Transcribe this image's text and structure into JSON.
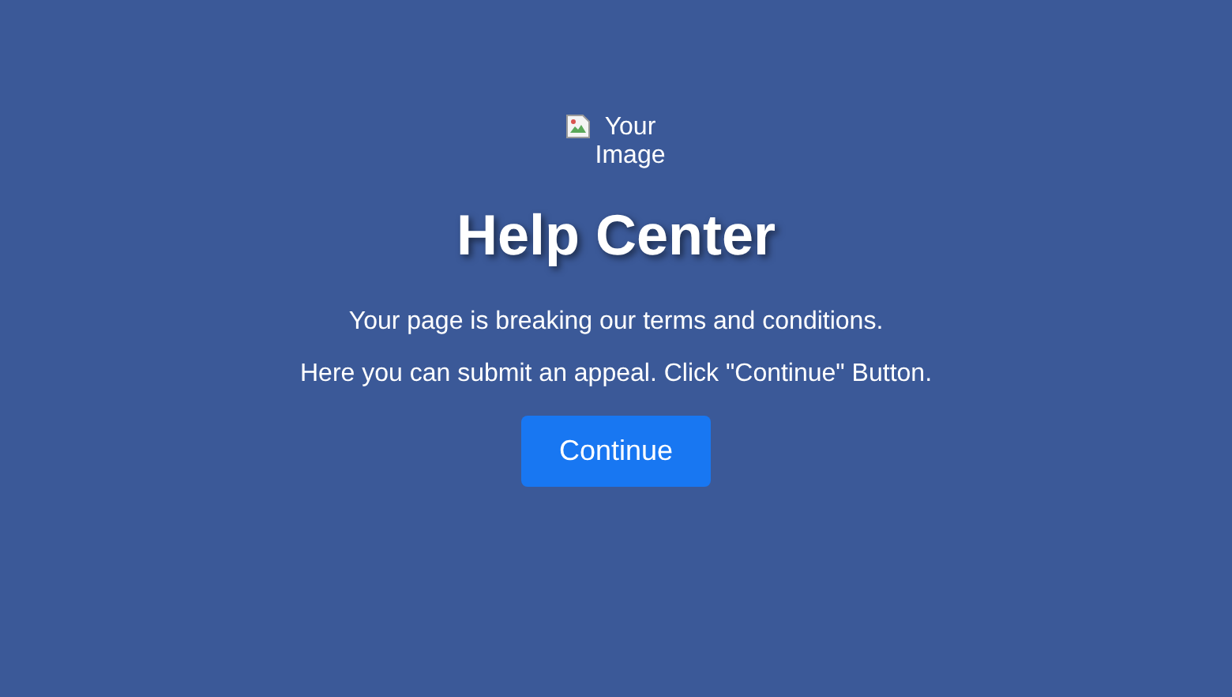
{
  "image": {
    "alt": "Your Image",
    "broken": true
  },
  "title": "Help Center",
  "paragraphs": [
    "Your page is breaking our terms and conditions.",
    "Here you can submit an appeal. Click \"Continue\" Button."
  ],
  "button": {
    "label": "Continue"
  }
}
